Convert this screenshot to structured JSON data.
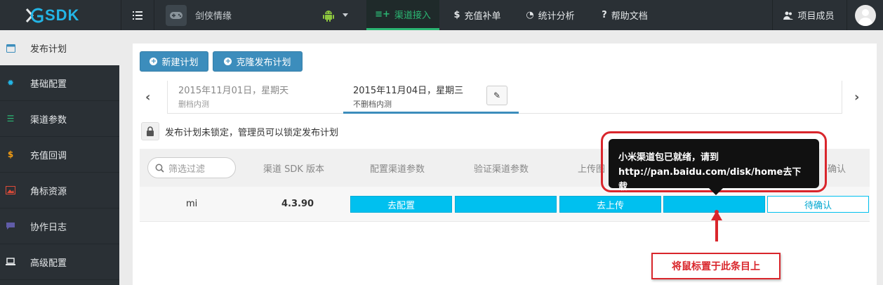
{
  "app": {
    "brand": "SDK"
  },
  "header": {
    "game_name": "剑侠情缘",
    "tabs": [
      {
        "label": "渠道接入",
        "icon": "plug-icon",
        "active": true
      },
      {
        "label": "充值补单",
        "icon": "dollar-icon",
        "active": false
      },
      {
        "label": "统计分析",
        "icon": "pie-chart-icon",
        "active": false
      },
      {
        "label": "帮助文档",
        "icon": "question-icon",
        "active": false
      }
    ],
    "members_label": "项目成员"
  },
  "sidebar": {
    "items": [
      {
        "label": "发布计划",
        "icon": "calendar-icon",
        "active": true
      },
      {
        "label": "基础配置",
        "icon": "gear-icon",
        "active": false
      },
      {
        "label": "渠道参数",
        "icon": "list-icon",
        "active": false
      },
      {
        "label": "充值回调",
        "icon": "dollar-icon",
        "active": false
      },
      {
        "label": "角标资源",
        "icon": "image-icon",
        "active": false
      },
      {
        "label": "协作日志",
        "icon": "comment-icon",
        "active": false
      },
      {
        "label": "高级配置",
        "icon": "laptop-icon",
        "active": false
      }
    ]
  },
  "toolbar": {
    "new_plan_label": "新建计划",
    "clone_plan_label": "克隆发布计划"
  },
  "plans": [
    {
      "date": "2015年11月01日，星期天",
      "subtitle": "删档内测",
      "active": false
    },
    {
      "date": "2015年11月04日，星期三",
      "subtitle": "不删档内测",
      "active": true
    }
  ],
  "lock_notice": "发布计划未锁定，管理员可以锁定发布计划",
  "table": {
    "search_placeholder": "筛选过滤",
    "columns": [
      "渠道 SDK 版本",
      "配置渠道参数",
      "验证渠道参数",
      "上传图",
      "确认"
    ],
    "rows": [
      {
        "channel": "mi",
        "sdk_version": "4.3.90",
        "configure_label": "去配置",
        "verify_label": "",
        "upload_label": "去上传",
        "col5_label": "",
        "confirm_label": "待确认"
      }
    ]
  },
  "tooltip": {
    "line1": "小米渠道包已就绪，请到",
    "line2": "http://pan.baidu.com/disk/home去下载"
  },
  "annotation": "将鼠标置于此条目上",
  "colors": {
    "topbar": "#2a3035",
    "brand": "#23b5e6",
    "active_tab": "#2bb673",
    "primary": "#3c8dbc",
    "info": "#00c0ef",
    "annotation_red": "#d9262c"
  }
}
